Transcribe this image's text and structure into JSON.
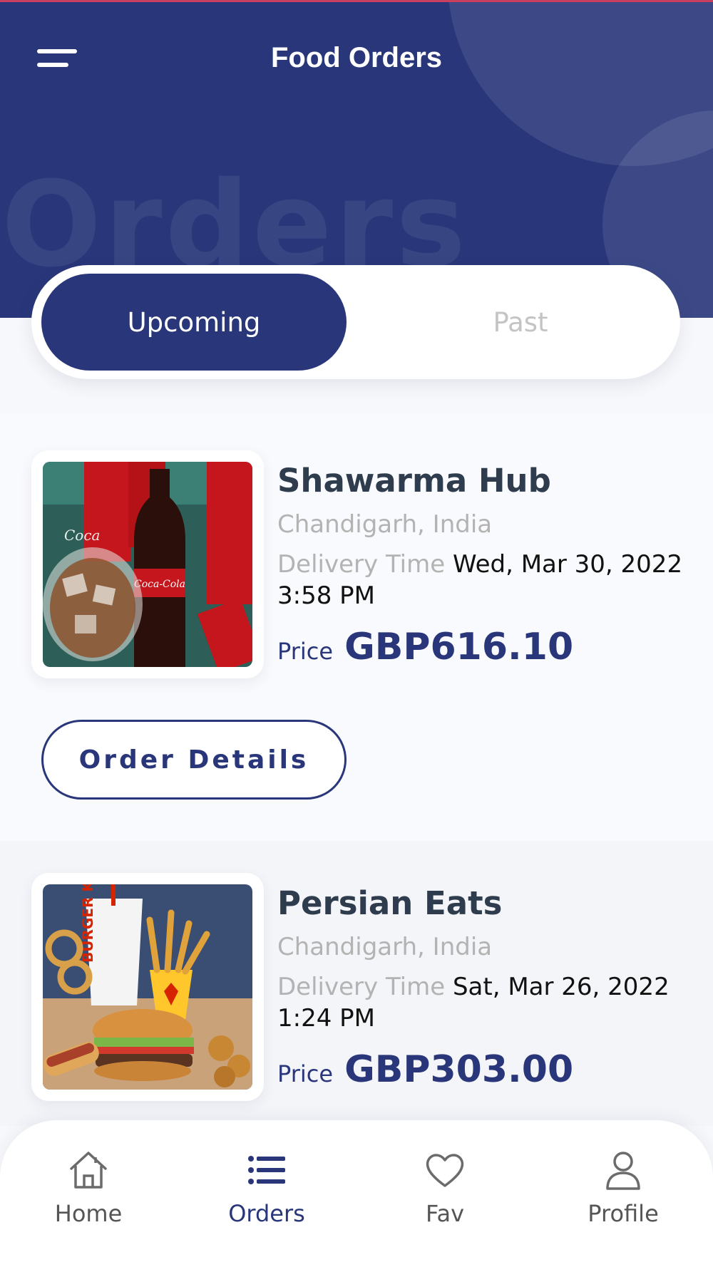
{
  "header": {
    "title": "Food Orders",
    "background_word": "Orders",
    "menu_icon": "menu-icon"
  },
  "tabs": [
    {
      "label": "Upcoming",
      "active": true
    },
    {
      "label": "Past",
      "active": false
    }
  ],
  "orders": [
    {
      "restaurant": "Shawarma Hub",
      "location": "Chandigarh, India",
      "delivery_label": "Delivery Time",
      "delivery_time_line1": "Wed, Mar 30, 2022",
      "delivery_time_line2": "3:58 PM",
      "price_label": "Price",
      "price": "GBP616.10",
      "image": "cola-drinks-image",
      "button_label": "Order Details"
    },
    {
      "restaurant": "Persian Eats",
      "location": "Chandigarh, India",
      "delivery_label": "Delivery Time",
      "delivery_time_line1": "Sat, Mar 26, 2022",
      "delivery_time_line2": "1:24 PM",
      "price_label": "Price",
      "price": "GBP303.00",
      "image": "burger-meal-image",
      "image_text": "BURGER KING"
    }
  ],
  "bottom_nav": [
    {
      "label": "Home",
      "icon": "home-icon",
      "active": false
    },
    {
      "label": "Orders",
      "icon": "list-icon",
      "active": true
    },
    {
      "label": "Fav",
      "icon": "heart-icon",
      "active": false
    },
    {
      "label": "Profile",
      "icon": "user-icon",
      "active": false
    }
  ],
  "colors": {
    "primary": "#29377a",
    "muted_text": "#b3b3b3",
    "background": "#f7f8fb"
  }
}
